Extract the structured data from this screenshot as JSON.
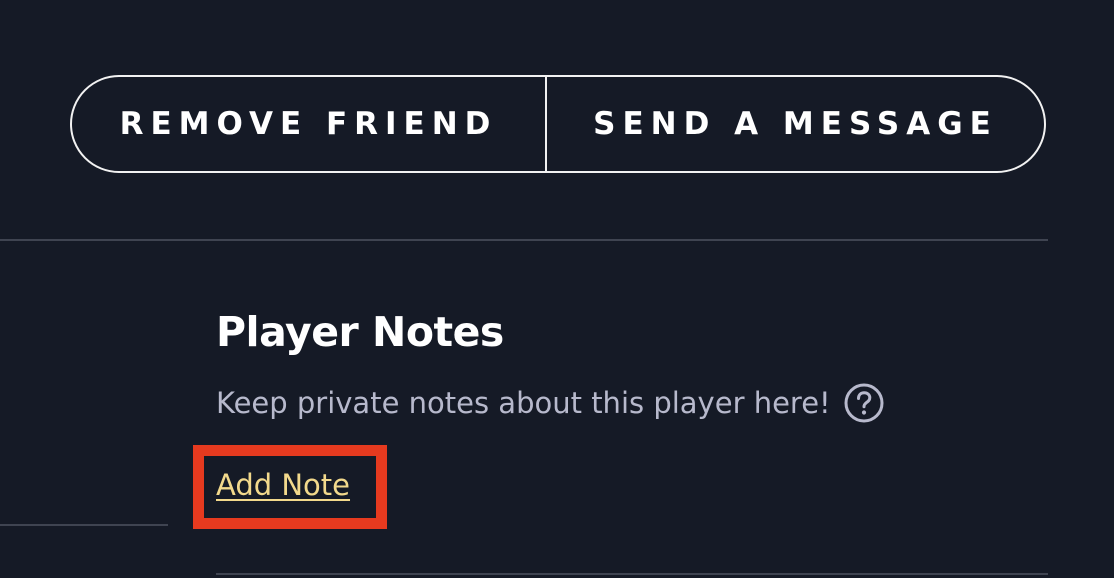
{
  "actions": {
    "remove_friend_label": "REMOVE FRIEND",
    "send_message_label": "SEND A MESSAGE"
  },
  "notes": {
    "title": "Player Notes",
    "description": "Keep private notes about this player here!",
    "help_icon": "question-circle-icon",
    "add_note_label": "Add Note"
  },
  "colors": {
    "background": "#151a26",
    "add_note_link": "#f2d98c",
    "highlight_box": "#e63a1f",
    "secondary_text": "#b7b9cc"
  }
}
